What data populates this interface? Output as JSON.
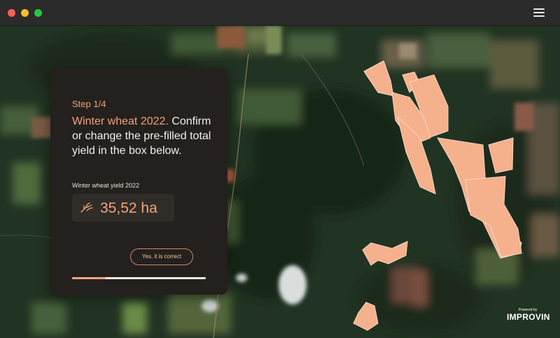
{
  "window": {
    "controls": [
      "close",
      "minimize",
      "maximize"
    ],
    "menu_icon": "hamburger-menu-icon"
  },
  "card": {
    "step": "Step 1/4",
    "heading_accent": "Winter wheat 2022.",
    "heading_rest": "Confirm or change the pre-filled total yield in the box below.",
    "field_label": "Winter wheat yield 2022",
    "yield_icon": "wheat-icon",
    "yield_value": "35,52 ha",
    "confirm_label": "Yes, it is correct",
    "progress_fraction": 0.25
  },
  "branding": {
    "powered_by": "Powered by",
    "logo_text": "IMPROVIN"
  },
  "colors": {
    "accent": "#f3a27c",
    "field_highlight": "#f5b08c",
    "card_bg": "#23201d"
  }
}
